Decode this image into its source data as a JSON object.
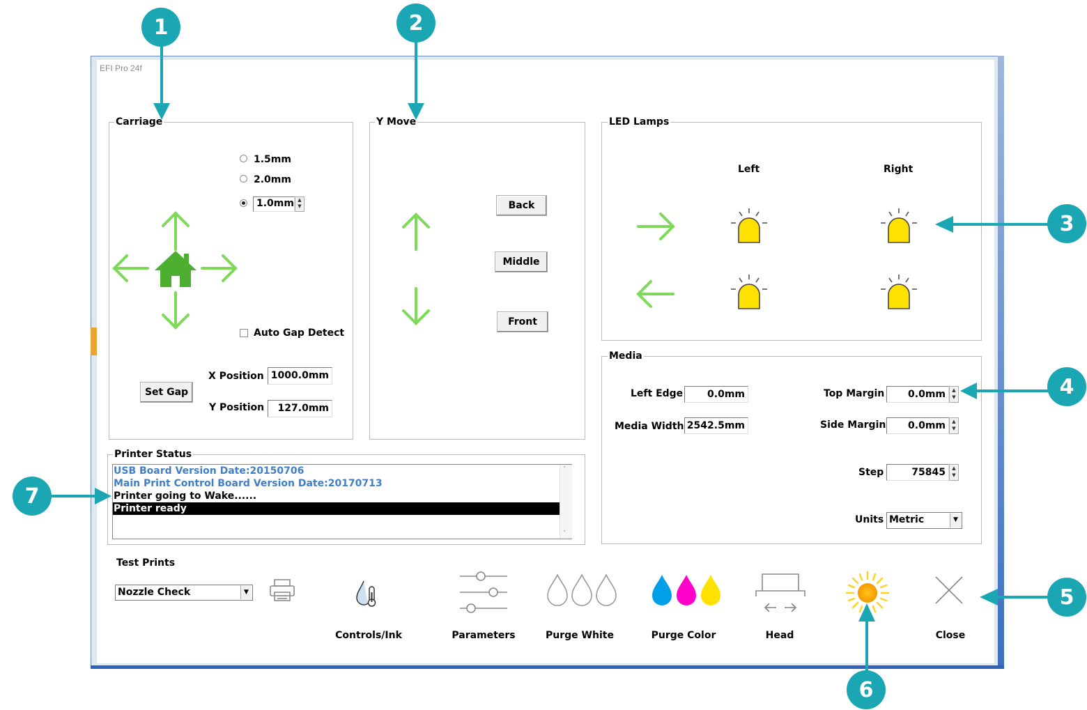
{
  "window": {
    "title": "EFI Pro 24f"
  },
  "carriage": {
    "label": "Carriage",
    "gap_options": [
      "1.5mm",
      "2.0mm"
    ],
    "gap_spin_value": "1.0mm",
    "auto_gap_label": "Auto Gap Detect",
    "auto_gap_checked": false,
    "set_gap_label": "Set Gap",
    "x_position_label": "X Position",
    "x_position_value": "1000.0mm",
    "y_position_label": "Y Position",
    "y_position_value": "127.0mm"
  },
  "y_move": {
    "label": "Y Move",
    "back": "Back",
    "middle": "Middle",
    "front": "Front"
  },
  "led": {
    "label": "LED Lamps",
    "left": "Left",
    "right": "Right"
  },
  "media": {
    "label": "Media",
    "left_edge_label": "Left Edge",
    "left_edge_value": "0.0mm",
    "media_width_label": "Media Width",
    "media_width_value": "2542.5mm",
    "top_margin_label": "Top Margin",
    "top_margin_value": "0.0mm",
    "side_margin_label": "Side Margin",
    "side_margin_value": "0.0mm",
    "step_label": "Step",
    "step_value": "75845",
    "units_label": "Units",
    "units_value": "Metric"
  },
  "printer_status": {
    "label": "Printer Status",
    "lines": [
      "USB Board Version Date:20150706",
      "Main Print Control Board Version Date:20170713",
      "Printer going to Wake......",
      "Printer ready"
    ]
  },
  "test_prints": {
    "label": "Test Prints",
    "selected": "Nozzle Check"
  },
  "toolbar": {
    "controls_ink": "Controls/Ink",
    "parameters": "Parameters",
    "purge_white": "Purge White",
    "purge_color": "Purge Color",
    "head": "Head",
    "close": "Close"
  },
  "callouts": [
    "1",
    "2",
    "3",
    "4",
    "5",
    "6",
    "7"
  ],
  "colors": {
    "arrow_green": "#7ed957",
    "home_green": "#4caf2f",
    "lamp_yellow": "#ffe100",
    "callout_teal": "#1aa6b3",
    "cyan": "#00a0e9",
    "magenta": "#ff00c8",
    "yellow": "#ffe100"
  }
}
